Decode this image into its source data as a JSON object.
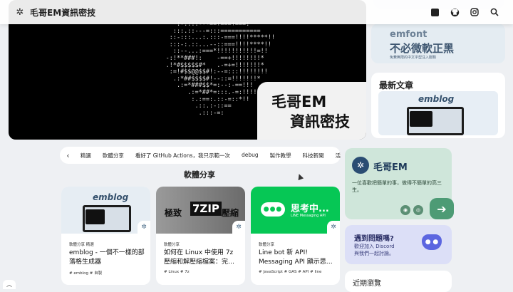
{
  "header": {
    "site_title": "毛哥EM資訊密技",
    "logo_icon": "snowflake-logo-icon",
    "icons": [
      "dark-mode-icon",
      "github-icon",
      "instagram-icon",
      "search-icon"
    ]
  },
  "hero": {
    "title_line1": "毛哥EM",
    "title_line2": "資訊密技",
    "ascii_art": "        :-.:::---==+===+===:\n       :::.::---=:::===========\n      ::-:::...:.:::-===!!!!*****!!\n      :::-:.::...--::===!!!!****!!\n       ::--...:===*!!!!!!!!!!!=!!\n     -:!**###!:    -==+!!!!!!!!*\n     .!*#$$$$$#*   .-=+=!!!!!!!*\n      :=!#$$@@$$#!:--=:::!!!!!!!!\n       .:*##$$$$#!--::=!!!!!!!*\n        .:=*###$$*=:--:-==!!!\n           .:=*##*=:::.-=:!!!!\n            :.:==:.::-=::*!!\n             .::.:-::==\n              .:::-=:"
  },
  "sidebar": {
    "emfont": {
      "logo": "emfont",
      "title": "不必微軟正黑",
      "subtitle": "免費無限的中文字型注入服務"
    },
    "latest": {
      "heading": "最新文章",
      "thumb_text": "emblog"
    },
    "profile": {
      "name": "毛哥EM",
      "description": "一位喜歡把簡單的事，做得不簡單的高三生。",
      "go_arrow": "➔"
    },
    "discord": {
      "heading": "遇到問題嗎?",
      "line1": "歡迎加入 Discord",
      "line2": "與我們一起討論。"
    },
    "recent": {
      "heading": "近期瀏覽"
    }
  },
  "categories": {
    "prev_arrow": "‹",
    "items": [
      "精選",
      "軟體分享",
      "看好了 GitHub Actions，我只示範一次",
      "debug",
      "製作教學",
      "科技新聞",
      "活動心"
    ]
  },
  "section": {
    "heading": "軟體分享"
  },
  "cards": [
    {
      "image_text": "emblog",
      "categories": "軟體分享 精選",
      "title": "emblog - 一個不一樣的部落格生成器",
      "tags": "# emblog # 自製"
    },
    {
      "image_text_left": "極致",
      "image_text_badge": "7ZIP",
      "image_text_right": "壓縮",
      "categories": "軟體分享",
      "title": "如何在 Linux 中使用 7z 壓縮和解壓縮檔案：完…",
      "tags": "# Linux # 7z"
    },
    {
      "image_text": "思考中...",
      "image_subtext": "LINE Messaging API",
      "categories": "軟體分享",
      "title": "Line bot 新 API! Messaging API 顯示思…",
      "tags": "# JavaScript # GAS # API # line"
    }
  ],
  "colors": {
    "page_bg": "#eef0f3",
    "profile_bg": "#cfe6da",
    "discord_bg": "#dcdff7",
    "line_green": "#06c755",
    "brand_navy": "#2a4d73"
  }
}
